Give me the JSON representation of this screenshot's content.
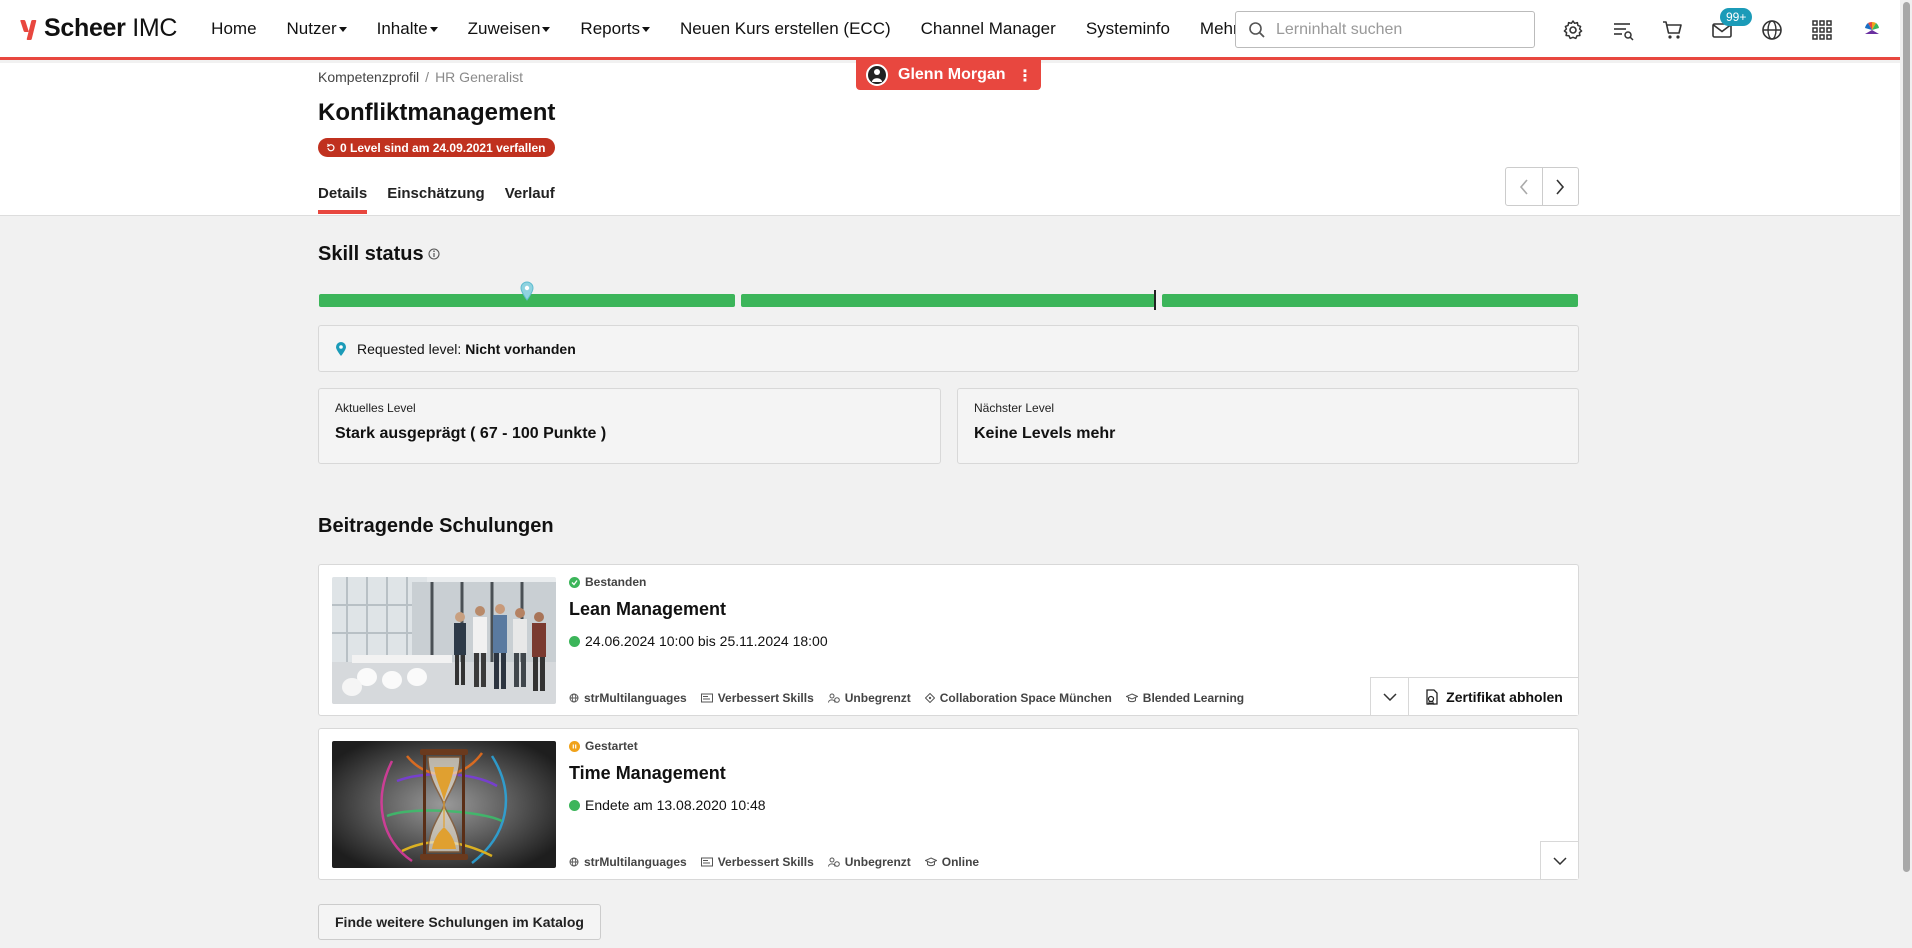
{
  "brand": {
    "name_bold": "Scheer",
    "name_light": " IMC",
    "accent": "#e8473f"
  },
  "nav": {
    "home": "Home",
    "nutzer": "Nutzer",
    "inhalte": "Inhalte",
    "zuweisen": "Zuweisen",
    "reports": "Reports",
    "neuer_kurs": "Neuen Kurs erstellen (ECC)",
    "channel_manager": "Channel Manager",
    "systeminfo": "Systeminfo",
    "mehr": "Mehr"
  },
  "search": {
    "placeholder": "Lerninhalt suchen"
  },
  "toolbar": {
    "messages_badge": "99+"
  },
  "impersonation": {
    "user_name": "Glenn Morgan",
    "more": "⋮"
  },
  "breadcrumb": {
    "parent": "Kompetenzprofil",
    "sep": "/",
    "current": "HR Generalist"
  },
  "page": {
    "title": "Konfliktmanagement",
    "expire_badge": "0 Level sind am 24.09.2021 verfallen"
  },
  "tabs": [
    {
      "label": "Details",
      "active": true
    },
    {
      "label": "Einschätzung",
      "active": false
    },
    {
      "label": "Verlauf",
      "active": false
    }
  ],
  "skill_status": {
    "title": "Skill status",
    "levels_count": 3,
    "requested_label": "Requested level:",
    "requested_value": "Nicht vorhanden",
    "current_level_label": "Aktuelles Level",
    "current_level_value": "Stark ausgeprägt ( 67 - 100 Punkte )",
    "next_level_label": "Nächster Level",
    "next_level_value": "Keine Levels mehr",
    "bar_color": "#3cb55a"
  },
  "courses_section": {
    "title": "Beitragende Schulungen"
  },
  "courses": [
    {
      "status": "Bestanden",
      "status_color": "#3cb55a",
      "title": "Lean Management",
      "date": "24.06.2024 10:00 bis 25.11.2024 18:00",
      "meta": [
        "strMultilanguages",
        "Verbessert Skills",
        "Unbegrenzt",
        "Collaboration Space München",
        "Blended Learning"
      ],
      "action": "Zertifikat abholen"
    },
    {
      "status": "Gestartet",
      "status_color": "#f0a21a",
      "title": "Time Management",
      "date": "Endete am 13.08.2020 10:48",
      "meta": [
        "strMultilanguages",
        "Verbessert Skills",
        "Unbegrenzt",
        "Online"
      ]
    }
  ],
  "catalog_button": "Finde weitere Schulungen im Katalog"
}
